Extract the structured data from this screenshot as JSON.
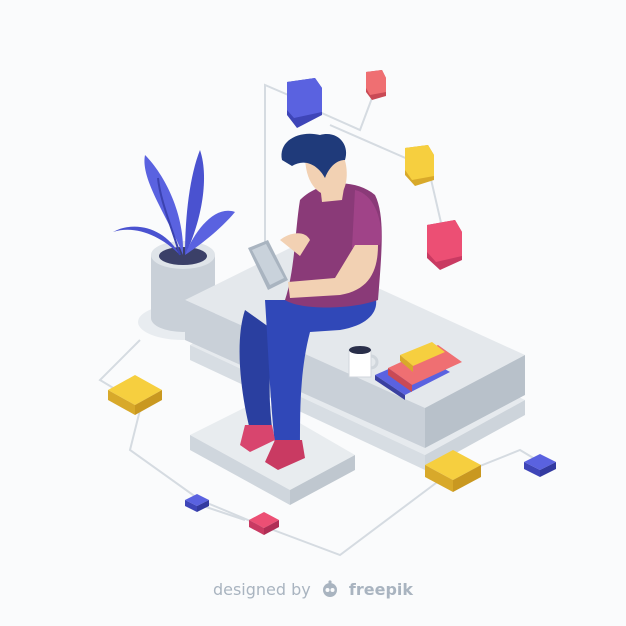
{
  "credit": {
    "prefix": "designed by",
    "brand": "freepik"
  },
  "colors": {
    "background": "#fafbfc",
    "platform_top": "#e4e8ec",
    "platform_side": "#c5ccd4",
    "shirt": "#8a3a78",
    "jeans": "#2a3fa0",
    "hair": "#1f3a7a",
    "shoes": "#d8456e",
    "plant": "#5a62e0",
    "cube_blue": "#5a62e0",
    "cube_yellow": "#f6cf3f",
    "cube_pink": "#ec4f74",
    "cube_red": "#ef6f72",
    "lines": "#d5dbe1"
  },
  "icons": [
    "freepik-logo-icon"
  ]
}
